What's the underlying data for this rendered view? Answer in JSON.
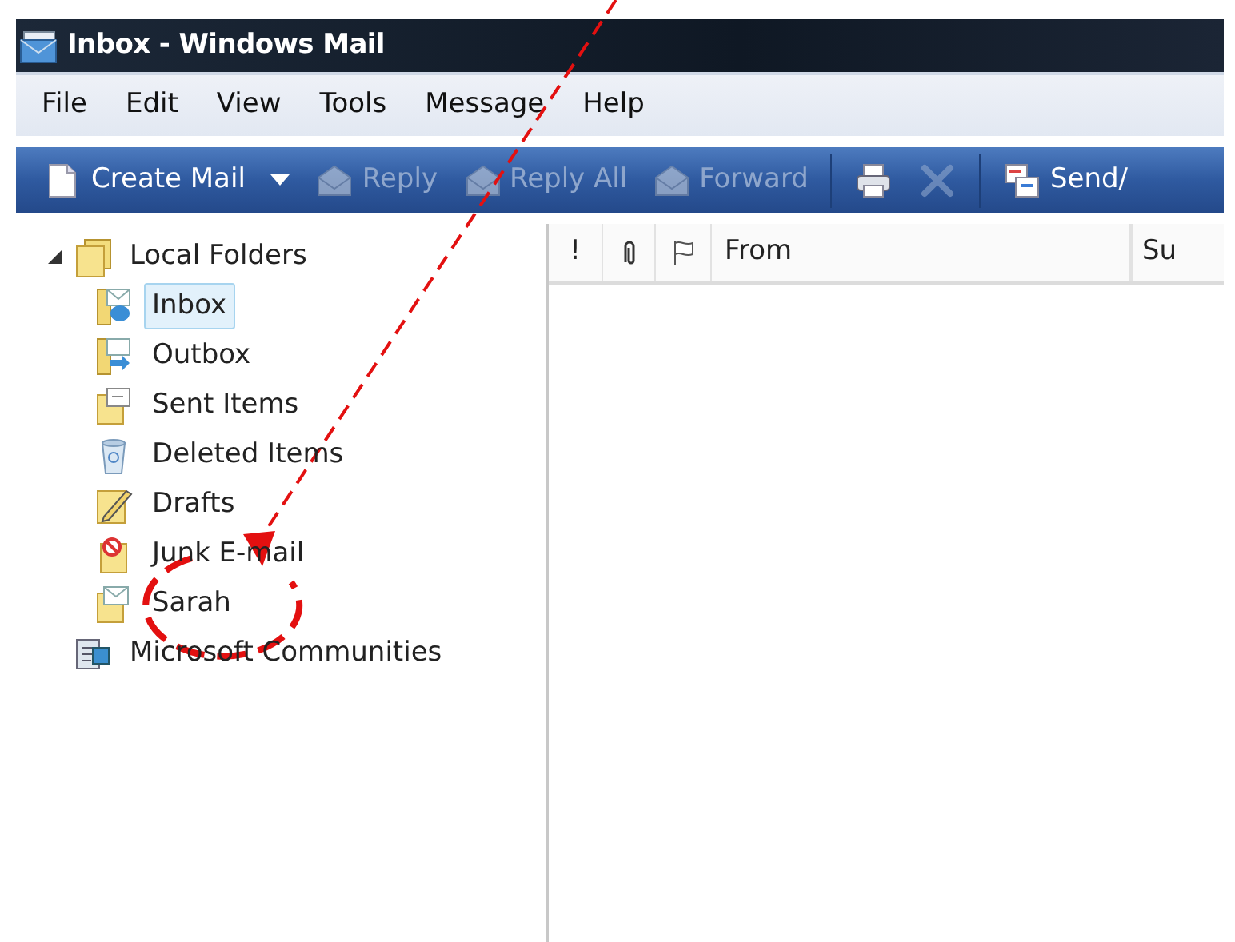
{
  "window": {
    "title": "Inbox - Windows Mail"
  },
  "menu": [
    "File",
    "Edit",
    "View",
    "Tools",
    "Message",
    "Help"
  ],
  "toolbar": [
    {
      "kind": "new",
      "label": "Create Mail",
      "disabled": false
    },
    {
      "kind": "caret",
      "disabled": false
    },
    {
      "kind": "reply",
      "label": "Reply",
      "disabled": true
    },
    {
      "kind": "replyall",
      "label": "Reply All",
      "disabled": true
    },
    {
      "kind": "forward",
      "label": "Forward",
      "disabled": true
    },
    {
      "kind": "separator"
    },
    {
      "kind": "print",
      "disabled": false
    },
    {
      "kind": "delete",
      "disabled": true
    },
    {
      "kind": "separator"
    },
    {
      "kind": "send",
      "label": "Send/",
      "disabled": false
    }
  ],
  "folders": [
    {
      "label": "Local Folders",
      "kind": "folder",
      "expanded": true,
      "selected": false,
      "children": [
        {
          "label": "Inbox",
          "kind": "inbox",
          "selected": true
        },
        {
          "label": "Outbox",
          "kind": "outbox",
          "selected": false
        },
        {
          "label": "Sent Items",
          "kind": "sent",
          "selected": false
        },
        {
          "label": "Deleted Items",
          "kind": "deleted",
          "selected": false
        },
        {
          "label": "Drafts",
          "kind": "drafts",
          "selected": false
        },
        {
          "label": "Junk E-mail",
          "kind": "junk",
          "selected": false
        },
        {
          "label": "Sarah",
          "kind": "mail",
          "selected": false
        }
      ]
    },
    {
      "label": "Microsoft Communities",
      "kind": "communities",
      "selected": false
    }
  ],
  "columns": [
    {
      "kind": "text",
      "label": "!"
    },
    {
      "kind": "attachment"
    },
    {
      "kind": "flag"
    },
    {
      "kind": "text",
      "label": "From"
    },
    {
      "kind": "text",
      "label": "Su"
    }
  ]
}
